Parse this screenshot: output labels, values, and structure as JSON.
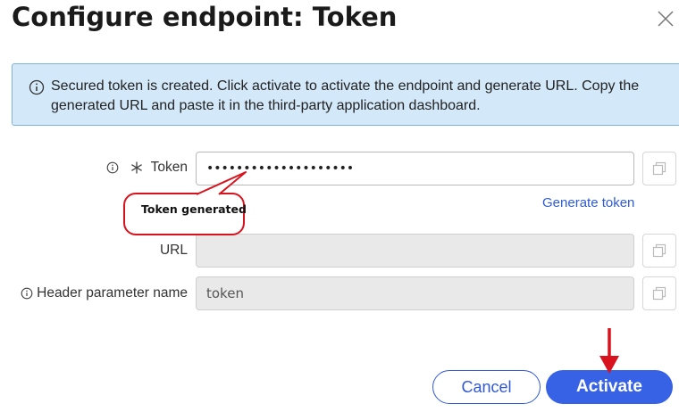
{
  "dialog": {
    "title": "Configure endpoint: Token",
    "close_icon": "close-icon"
  },
  "banner": {
    "icon": "info-icon",
    "message": "Secured token is created. Click activate to activate the endpoint and generate URL. Copy the generated URL and paste it in the third-party application dashboard."
  },
  "form": {
    "token": {
      "label": "Token",
      "required": true,
      "value": "••••••••••••••••••••",
      "copy_icon": "copy-icon"
    },
    "generate_link": "Generate token",
    "url": {
      "label": "URL",
      "value": "",
      "copy_icon": "copy-icon"
    },
    "header_param": {
      "label": "Header parameter name",
      "value": "token",
      "copy_icon": "copy-icon"
    }
  },
  "annotation": {
    "callout_text": "Token generated",
    "highlight_color": "#d8131e"
  },
  "footer": {
    "cancel_label": "Cancel",
    "activate_label": "Activate"
  },
  "colors": {
    "primary": "#3862e6",
    "banner_bg": "#d3e8f9",
    "banner_border": "#7fb3df",
    "link": "#2f5bd7"
  }
}
